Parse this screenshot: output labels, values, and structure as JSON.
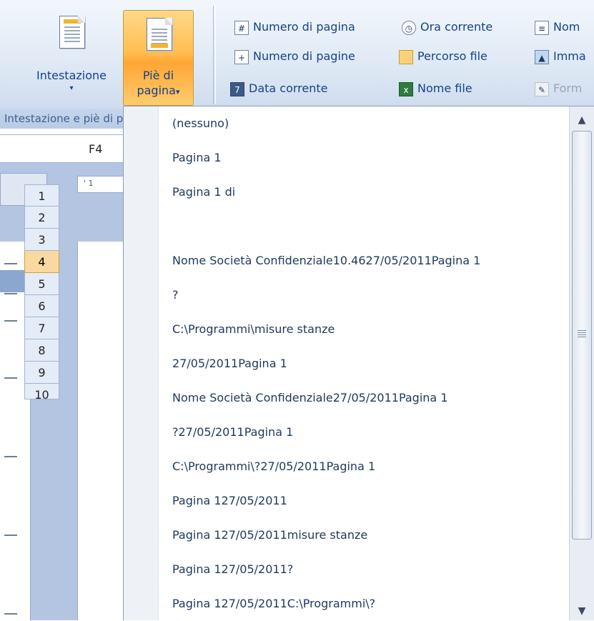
{
  "ribbon": {
    "intestazione_label": "Intestazione",
    "pie_line1": "Piè di",
    "pie_line2": "pagina",
    "dropdown_arrow": "▾",
    "small_buttons": [
      {
        "label": "Numero di pagina",
        "icon": "page-number-icon",
        "glyph": "#"
      },
      {
        "label": "Numero di pagine",
        "icon": "page-count-icon",
        "glyph": "+"
      },
      {
        "label": "Data corrente",
        "icon": "calendar-icon",
        "glyph": "7"
      },
      {
        "label": "Ora corrente",
        "icon": "clock-icon",
        "glyph": "◷"
      },
      {
        "label": "Percorso file",
        "icon": "folder-icon",
        "glyph": ""
      },
      {
        "label": "Nome file",
        "icon": "file-name-icon",
        "glyph": "x"
      },
      {
        "label": "Nom",
        "icon": "sheet-name-icon",
        "glyph": "≡"
      },
      {
        "label": "Imma",
        "icon": "picture-icon",
        "glyph": "▲"
      },
      {
        "label": "Form",
        "icon": "format-picture-icon",
        "glyph": "✎"
      }
    ],
    "group_label": "Intestazione e piè di pagina"
  },
  "sheet": {
    "cell_ref": "F4",
    "ruler_marks": "' 1",
    "row_numbers": [
      "1",
      "2",
      "3",
      "4",
      "5",
      "6",
      "7",
      "8",
      "9",
      "10"
    ],
    "active_row": "4"
  },
  "dropdown": {
    "options": [
      "(nessuno)",
      "Pagina 1",
      "Pagina 1 di",
      "",
      "Nome Società Confidenziale10.4627/05/2011Pagina 1",
      "?",
      "C:\\Programmi\\misure stanze",
      "27/05/2011Pagina 1",
      "Nome Società Confidenziale27/05/2011Pagina 1",
      "?27/05/2011Pagina 1",
      "C:\\Programmi\\?27/05/2011Pagina 1",
      "Pagina 127/05/2011",
      "Pagina 127/05/2011misure stanze",
      "Pagina 127/05/2011?",
      "Pagina 127/05/2011C:\\Programmi\\?"
    ]
  },
  "colors": {
    "ribbon_bg": "#dfe9f5",
    "active_button": "#ffbd4f",
    "text": "#1e395b",
    "active_row": "#f9d99f"
  }
}
